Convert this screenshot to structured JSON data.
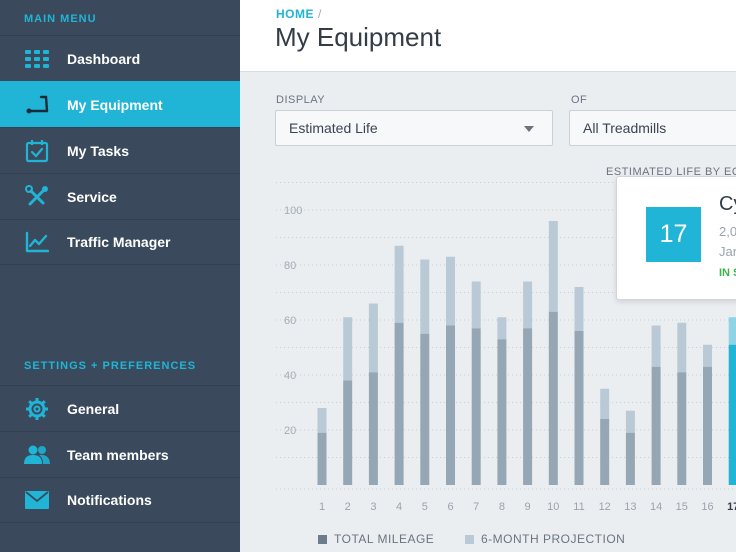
{
  "sidebar": {
    "main_menu_title": "MAIN MENU",
    "settings_title": "SETTINGS + PREFERENCES",
    "main_items": [
      {
        "label": "Dashboard",
        "icon": "grid-icon"
      },
      {
        "label": "My Equipment",
        "icon": "treadmill-icon",
        "active": true
      },
      {
        "label": "My Tasks",
        "icon": "calendar-check-icon"
      },
      {
        "label": "Service",
        "icon": "tools-icon"
      },
      {
        "label": "Traffic Manager",
        "icon": "line-chart-icon"
      }
    ],
    "settings_items": [
      {
        "label": "General",
        "icon": "gear-icon"
      },
      {
        "label": "Team members",
        "icon": "team-icon"
      },
      {
        "label": "Notifications",
        "icon": "envelope-icon"
      }
    ]
  },
  "header": {
    "breadcrumb": "HOME",
    "breadcrumb_sep": "/",
    "title": "My Equipment"
  },
  "filters": {
    "display_label": "DISPLAY",
    "display_value": "Estimated Life",
    "of_label": "OF",
    "of_value": "All Treadmills"
  },
  "chart_caption": "ESTIMATED LIFE BY EQ",
  "tooltip": {
    "id": "17",
    "name": "Cy",
    "miles": "2,0",
    "date": "Jan",
    "status": "IN S"
  },
  "legend": {
    "total": "TOTAL MILEAGE",
    "projection": "6-MONTH PROJECTION"
  },
  "colors": {
    "accent": "#20b4d6",
    "sidebar": "#3a4a5c",
    "total_bar": "#95a6b5",
    "projection_bar": "#b9cad6",
    "status_green": "#3cb34a"
  },
  "chart_data": {
    "type": "bar",
    "stacked": true,
    "title": "ESTIMATED LIFE BY EQ",
    "categories": [
      "1",
      "2",
      "3",
      "4",
      "5",
      "6",
      "7",
      "8",
      "9",
      "10",
      "11",
      "12",
      "13",
      "14",
      "15",
      "16",
      "17"
    ],
    "series": [
      {
        "name": "TOTAL MILEAGE",
        "values": [
          19,
          38,
          41,
          59,
          55,
          58,
          57,
          53,
          57,
          63,
          56,
          24,
          19,
          43,
          41,
          43,
          51
        ]
      },
      {
        "name": "6-MONTH PROJECTION",
        "values": [
          9,
          23,
          25,
          28,
          27,
          25,
          17,
          8,
          17,
          33,
          16,
          11,
          8,
          15,
          18,
          8,
          10
        ]
      }
    ],
    "yticks": [
      20,
      40,
      60,
      80,
      100
    ],
    "ylim": [
      0,
      105
    ],
    "highlight_category": "17",
    "grid": true
  }
}
